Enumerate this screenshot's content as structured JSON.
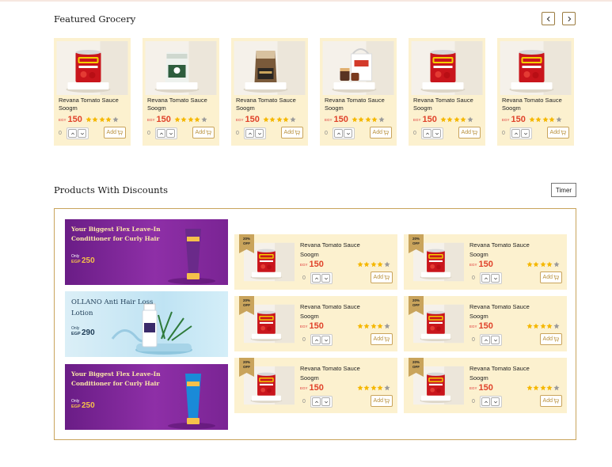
{
  "featured": {
    "title": "Featured Grocery",
    "prev_icon": "chevron-left-icon",
    "next_icon": "chevron-right-icon",
    "products": [
      {
        "name_line1": "Revana Tomato Sauce",
        "name_line2": "Soogm",
        "currency": "EGY",
        "price": "150",
        "rating": 4,
        "qty": "0",
        "add_label": "Add",
        "image": "tomato-can"
      },
      {
        "name_line1": "Revana Tomato Sauce",
        "name_line2": "Soogm",
        "currency": "EGY",
        "price": "150",
        "rating": 4,
        "qty": "0",
        "add_label": "Add",
        "image": "green-pouch"
      },
      {
        "name_line1": "Revana Tomato Sauce",
        "name_line2": "Soogm",
        "currency": "EGY",
        "price": "150",
        "rating": 4,
        "qty": "0",
        "add_label": "Add",
        "image": "coffee-bag"
      },
      {
        "name_line1": "Revana Tomato Sauce",
        "name_line2": "Soogm",
        "currency": "EGY",
        "price": "150",
        "rating": 4,
        "qty": "0",
        "add_label": "Add",
        "image": "jars-bag"
      },
      {
        "name_line1": "Revana Tomato Sauce",
        "name_line2": "Soogm",
        "currency": "EGY",
        "price": "150",
        "rating": 4,
        "qty": "0",
        "add_label": "Add",
        "image": "tomato-can"
      },
      {
        "name_line1": "Revana Tomato Sauce",
        "name_line2": "Soogm",
        "currency": "EGY",
        "price": "150",
        "rating": 4,
        "qty": "0",
        "add_label": "Add",
        "image": "tomato-can"
      }
    ]
  },
  "discounts": {
    "title": "Products With Discounts",
    "timer_label": "Timer",
    "banners": [
      {
        "title": "Your Biggest Flex Leave-In Conditioner for Curly Hair",
        "only": "Only",
        "currency": "EGP",
        "price": "250",
        "style": "purple"
      },
      {
        "title": "OLLANO Anti Hair Loss Lotion",
        "only": "Only",
        "currency": "EGP",
        "price": "290",
        "style": "blue"
      },
      {
        "title": "Your Biggest Flex Leave-In Conditioner for Curly Hair",
        "only": "Only",
        "currency": "EGP",
        "price": "250",
        "style": "purple"
      }
    ],
    "products": [
      {
        "badge_pct": "20%",
        "badge_off": "OFF",
        "name_line1": "Revana Tomato Sauce",
        "name_line2": "Soogm",
        "currency": "EGY",
        "price": "150",
        "rating": 4,
        "qty": "0",
        "add_label": "Add"
      },
      {
        "badge_pct": "20%",
        "badge_off": "OFF",
        "name_line1": "Revana Tomato Sauce",
        "name_line2": "Soogm",
        "currency": "EGY",
        "price": "150",
        "rating": 4,
        "qty": "0",
        "add_label": "Add"
      },
      {
        "badge_pct": "20%",
        "badge_off": "OFF",
        "name_line1": "Revana Tomato Sauce",
        "name_line2": "Soogm",
        "currency": "EGY",
        "price": "150",
        "rating": 4,
        "qty": "0",
        "add_label": "Add"
      },
      {
        "badge_pct": "20%",
        "badge_off": "OFF",
        "name_line1": "Revana Tomato Sauce",
        "name_line2": "Soogm",
        "currency": "EGY",
        "price": "150",
        "rating": 4,
        "qty": "0",
        "add_label": "Add"
      },
      {
        "badge_pct": "20%",
        "badge_off": "OFF",
        "name_line1": "Revana Tomato Sauce",
        "name_line2": "Soogm",
        "currency": "EGY",
        "price": "150",
        "rating": 4,
        "qty": "0",
        "add_label": "Add"
      },
      {
        "badge_pct": "20%",
        "badge_off": "OFF",
        "name_line1": "Revana Tomato Sauce",
        "name_line2": "Soogm",
        "currency": "EGY",
        "price": "150",
        "rating": 4,
        "qty": "0",
        "add_label": "Add"
      }
    ]
  },
  "colors": {
    "card_bg": "#fcf1cf",
    "accent_gold": "#c9a45c",
    "price_red": "#e0422a",
    "star_gold": "#f5b700",
    "star_gray": "#9a9a9a"
  }
}
